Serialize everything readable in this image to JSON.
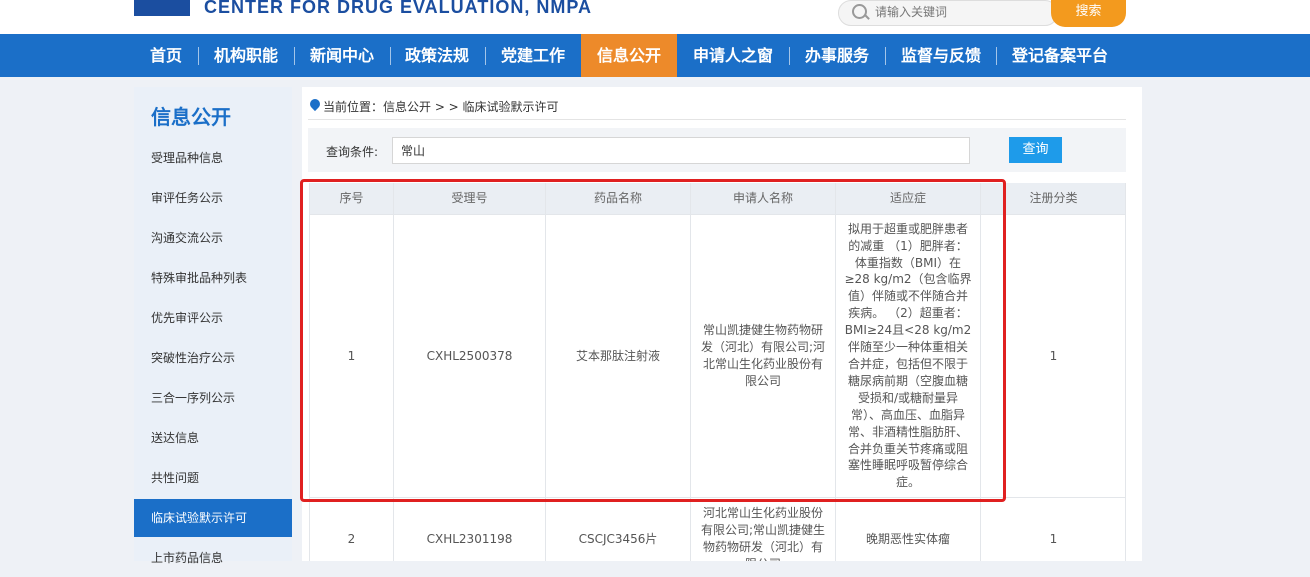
{
  "header": {
    "site_name_en": "CENTER FOR DRUG EVALUATION, NMPA",
    "search_placeholder": "请输入关键词",
    "search_button": "搜索"
  },
  "nav": {
    "items": [
      {
        "label": "首页"
      },
      {
        "label": "机构职能"
      },
      {
        "label": "新闻中心"
      },
      {
        "label": "政策法规"
      },
      {
        "label": "党建工作"
      },
      {
        "label": "信息公开",
        "active": true
      },
      {
        "label": "申请人之窗"
      },
      {
        "label": "办事服务"
      },
      {
        "label": "监督与反馈"
      },
      {
        "label": "登记备案平台"
      }
    ],
    "active_color": "#ed8a2a",
    "bar_color": "#1b6fc8"
  },
  "sidebar": {
    "title": "信息公开",
    "items": [
      {
        "label": "受理品种信息"
      },
      {
        "label": "审评任务公示"
      },
      {
        "label": "沟通交流公示"
      },
      {
        "label": "特殊审批品种列表"
      },
      {
        "label": "优先审评公示"
      },
      {
        "label": "突破性治疗公示"
      },
      {
        "label": "三合一序列公示"
      },
      {
        "label": "送达信息"
      },
      {
        "label": "共性问题"
      },
      {
        "label": "临床试验默示许可",
        "active": true
      },
      {
        "label": "上市药品信息"
      }
    ]
  },
  "breadcrumb": "当前位置：信息公开 > > 临床试验默示许可",
  "query": {
    "label": "查询条件:",
    "value": "常山",
    "button": "查询"
  },
  "table": {
    "headers": [
      "序号",
      "受理号",
      "药品名称",
      "申请人名称",
      "适应症",
      "",
      "注册分类"
    ],
    "rows": [
      {
        "no": "1",
        "acceptance_no": "CXHL2500378",
        "drug_name": "艾本那肽注射液",
        "applicant": "常山凯捷健生物药物研发（河北）有限公司;河北常山生化药业股份有限公司",
        "indication": "拟用于超重或肥胖患者的减重 （1）肥胖者：体重指数（BMI）在≥28 kg/m2（包含临界值）伴随或不伴随合并疾病。 （2）超重者：BMI≥24且<28 kg/m2伴随至少一种体重相关合并症，包括但不限于糖尿病前期（空腹血糖受损和/或糖耐量异常）、高血压、血脂异常、非酒精性脂肪肝、合并负重关节疼痛或阻塞性睡眠呼吸暂停综合症。",
        "extra": "",
        "category": "1"
      },
      {
        "no": "2",
        "acceptance_no": "CXHL2301198",
        "drug_name": "CSCJC3456片",
        "applicant": "河北常山生化药业股份有限公司;常山凯捷健生物药物研发（河北）有限公司",
        "indication": "晚期恶性实体瘤",
        "extra": "",
        "category": "1"
      }
    ]
  },
  "highlight_color": "#e02020"
}
